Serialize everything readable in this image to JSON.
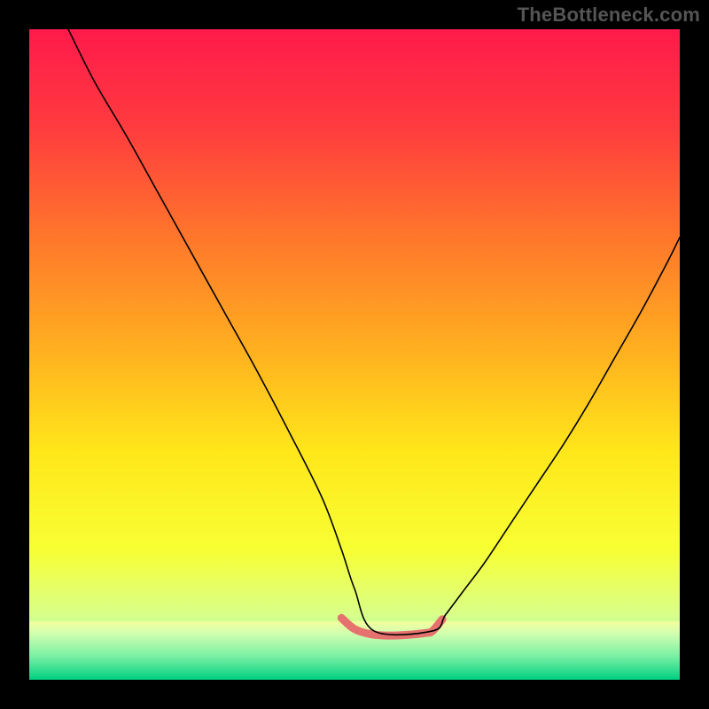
{
  "watermark": "TheBottleneck.com",
  "chart_data": {
    "type": "line",
    "title": "",
    "xlabel": "",
    "ylabel": "",
    "xlim": [
      0,
      100
    ],
    "ylim": [
      0,
      100
    ],
    "grid": false,
    "series": [
      {
        "name": "black-curve",
        "color": "#000000",
        "width": 1.6,
        "x": [
          6,
          10,
          15,
          20,
          25,
          30,
          35,
          40,
          45,
          48,
          50,
          53,
          62,
          64,
          67,
          70,
          74,
          78,
          82,
          86,
          90,
          94,
          98,
          100
        ],
        "values": [
          100,
          92,
          83.5,
          74.5,
          65.5,
          56.5,
          47.5,
          38,
          28,
          20,
          14,
          7.5,
          7.5,
          10,
          14,
          18,
          24,
          30,
          36,
          42.5,
          49.5,
          56.5,
          64,
          68
        ]
      },
      {
        "name": "pink-highlight",
        "color": "#e6726f",
        "width": 9,
        "x": [
          48,
          50,
          52.5,
          55,
          58,
          61,
          62,
          63.5
        ],
        "values": [
          9.5,
          7.8,
          7.0,
          6.8,
          6.9,
          7.2,
          7.5,
          9.3
        ]
      }
    ],
    "background_gradient": {
      "stops": [
        {
          "offset": 0.0,
          "color": "#ff1a4b"
        },
        {
          "offset": 0.15,
          "color": "#ff3b3f"
        },
        {
          "offset": 0.33,
          "color": "#ff7a2a"
        },
        {
          "offset": 0.5,
          "color": "#ffb21f"
        },
        {
          "offset": 0.65,
          "color": "#ffe71a"
        },
        {
          "offset": 0.8,
          "color": "#f7ff33"
        },
        {
          "offset": 0.9,
          "color": "#d9ff8a"
        },
        {
          "offset": 0.96,
          "color": "#8affad"
        },
        {
          "offset": 1.0,
          "color": "#19e08c"
        }
      ]
    },
    "bottom_band": {
      "from_y": 0,
      "to_y": 9,
      "stops": [
        {
          "offset": 0.0,
          "color": "#00cf80"
        },
        {
          "offset": 0.4,
          "color": "#7af0a4"
        },
        {
          "offset": 0.8,
          "color": "#d2ffb0"
        },
        {
          "offset": 1.0,
          "color": "#f4ff9c"
        }
      ]
    }
  }
}
